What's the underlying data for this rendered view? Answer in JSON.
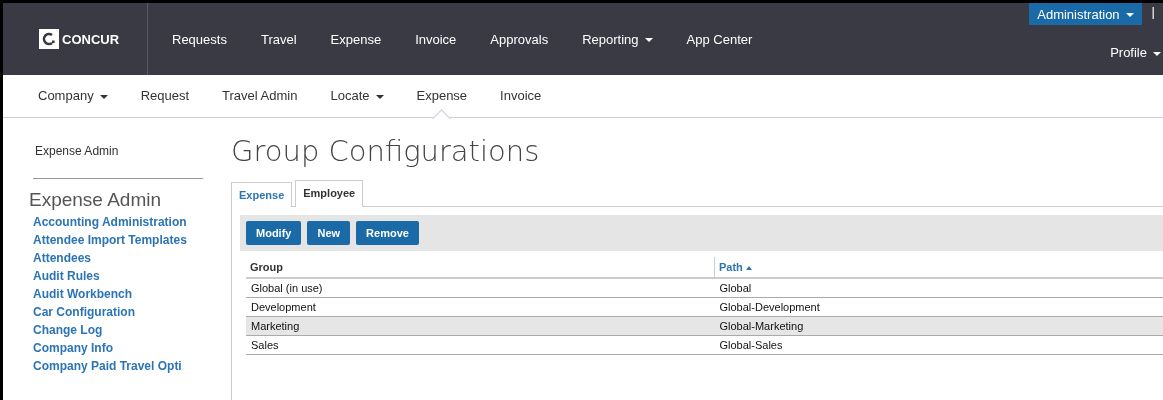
{
  "top_nav": {
    "logo": "CONCUR",
    "items": [
      {
        "label": "Requests",
        "dropdown": false
      },
      {
        "label": "Travel",
        "dropdown": false
      },
      {
        "label": "Expense",
        "dropdown": false
      },
      {
        "label": "Invoice",
        "dropdown": false
      },
      {
        "label": "Approvals",
        "dropdown": false
      },
      {
        "label": "Reporting",
        "dropdown": true
      },
      {
        "label": "App Center",
        "dropdown": false
      }
    ],
    "admin_button": "Administration",
    "divider": "|",
    "profile": "Profile"
  },
  "sub_nav": [
    {
      "label": "Company",
      "dropdown": true,
      "selected": false
    },
    {
      "label": "Request",
      "dropdown": false,
      "selected": false
    },
    {
      "label": "Travel Admin",
      "dropdown": false,
      "selected": false
    },
    {
      "label": "Locate",
      "dropdown": true,
      "selected": false
    },
    {
      "label": "Expense",
      "dropdown": false,
      "selected": true
    },
    {
      "label": "Invoice",
      "dropdown": false,
      "selected": false
    }
  ],
  "sidebar": {
    "breadcrumb": "Expense Admin",
    "heading": "Expense Admin",
    "items": [
      "Accounting Administration",
      "Attendee Import Templates",
      "Attendees",
      "Audit Rules",
      "Audit Workbench",
      "Car Configuration",
      "Change Log",
      "Company Info",
      "Company Paid Travel Opti"
    ]
  },
  "page_title": "Group Configurations",
  "tabs": [
    {
      "label": "Expense",
      "selected": false
    },
    {
      "label": "Employee",
      "selected": true
    }
  ],
  "buttons": [
    "Modify",
    "New",
    "Remove"
  ],
  "table": {
    "columns": [
      {
        "label": "Group",
        "sorted": false
      },
      {
        "label": "Path",
        "sorted": true
      }
    ],
    "rows": [
      {
        "cells": [
          "Global (in use)",
          "Global"
        ],
        "selected": false
      },
      {
        "cells": [
          "Development",
          "Global-Development"
        ],
        "selected": false
      },
      {
        "cells": [
          "Marketing",
          "Global-Marketing"
        ],
        "selected": true
      },
      {
        "cells": [
          "Sales",
          "Global-Sales"
        ],
        "selected": false
      }
    ]
  }
}
